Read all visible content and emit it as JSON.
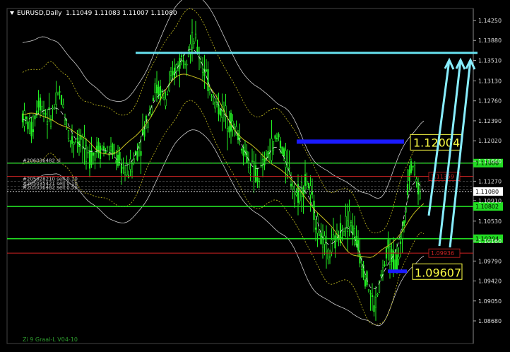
{
  "header": {
    "symbol": "EURUSD,Daily",
    "ohlc": "1.11049 1.11083 1.11007 1.11080"
  },
  "footer": {
    "indicator_label": "Zi 9 Graal-L V04-10"
  },
  "price_axis": {
    "ticks": [
      "1.14250",
      "1.13880",
      "1.13510",
      "1.13130",
      "1.12760",
      "1.12390",
      "1.12020",
      "1.11640",
      "1.11270",
      "1.10910",
      "1.10530",
      "1.10160",
      "1.09790",
      "1.09420",
      "1.09050",
      "1.08680"
    ],
    "min": 1.0868,
    "max": 1.1425
  },
  "levels": [
    {
      "price": 1.11606,
      "label": "1.11606",
      "kind": "green",
      "color": "#22dd22"
    },
    {
      "price": 1.10802,
      "label": "1.10802",
      "kind": "green",
      "color": "#22dd22"
    },
    {
      "price": 1.10204,
      "label": "1.10204",
      "kind": "green",
      "color": "#22dd22"
    },
    {
      "price": 1.11359,
      "label": "1.11359",
      "kind": "red",
      "color": "#cc2222"
    },
    {
      "price": 1.09936,
      "label": "1.09936",
      "kind": "red",
      "color": "#cc2222"
    },
    {
      "price": 1.1108,
      "label": "1.11080",
      "kind": "current",
      "color": "#dddddd"
    }
  ],
  "order_labels": [
    {
      "text": "#206036482 sl",
      "price": 1.11606
    },
    {
      "text": "#205028210 sell 0.10",
      "price": 1.1127
    },
    {
      "text": "#205035421 sell 0.10",
      "price": 1.1118
    },
    {
      "text": "#205036482 sell 0.50",
      "price": 1.1111
    }
  ],
  "annotations": [
    {
      "text": "1.12004",
      "price": 1.12004,
      "color": "#ffff44"
    },
    {
      "text": "1.09607",
      "price": 1.09607,
      "color": "#ffff44"
    }
  ],
  "target_line": {
    "price": 1.1365,
    "color": "#66e0ee"
  },
  "colors": {
    "background": "#000000",
    "candles": "#22ee22",
    "bands": "#cccccc",
    "ma_yellow": "#c8c020",
    "ma_white": "#dddddd",
    "arrow": "#88eeff",
    "blue_bar": "#1a1aff"
  }
}
